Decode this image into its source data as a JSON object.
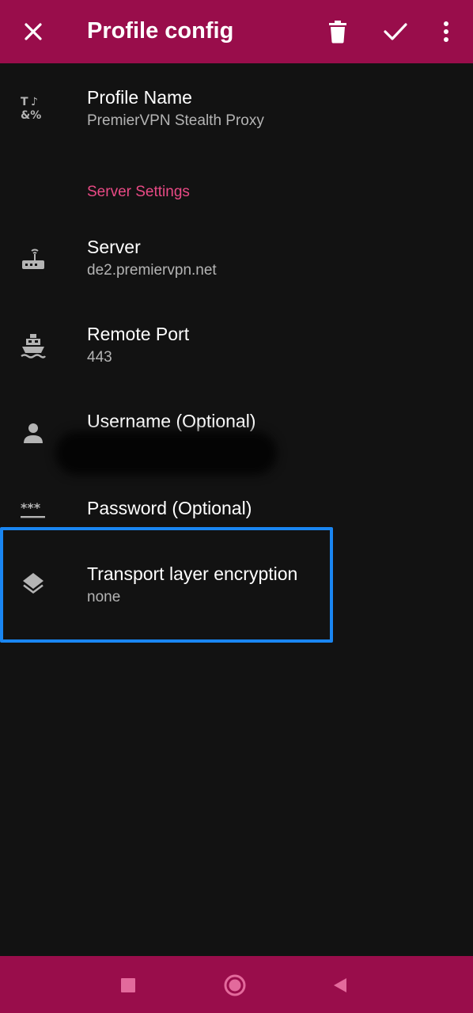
{
  "toolbar": {
    "title": "Profile config",
    "close_icon": "close-icon",
    "delete_icon": "trash-icon",
    "save_icon": "check-icon",
    "more_icon": "more-vert-icon"
  },
  "profile_name": {
    "title": "Profile Name",
    "summary": "PremierVPN Stealth Proxy",
    "icon": "text-format-icon"
  },
  "server_settings": {
    "category_title": "Server Settings",
    "server": {
      "title": "Server",
      "summary": "de2.premiervpn.net",
      "icon": "router-icon"
    },
    "remote_port": {
      "title": "Remote Port",
      "summary": "443",
      "icon": "ship-icon"
    },
    "username": {
      "title": "Username (Optional)",
      "icon": "person-icon"
    },
    "password": {
      "title": "Password (Optional)",
      "icon": "password-icon"
    },
    "transport_encryption": {
      "title": "Transport layer encryption",
      "summary": "none",
      "icon": "layers-icon"
    }
  },
  "navbar": {
    "recents_icon": "square-icon",
    "home_icon": "circle-icon",
    "back_icon": "triangle-back-icon"
  },
  "colors": {
    "accent": "#990d4b",
    "category": "#e94a85",
    "background": "#121212",
    "highlight": "#1a86f2"
  }
}
